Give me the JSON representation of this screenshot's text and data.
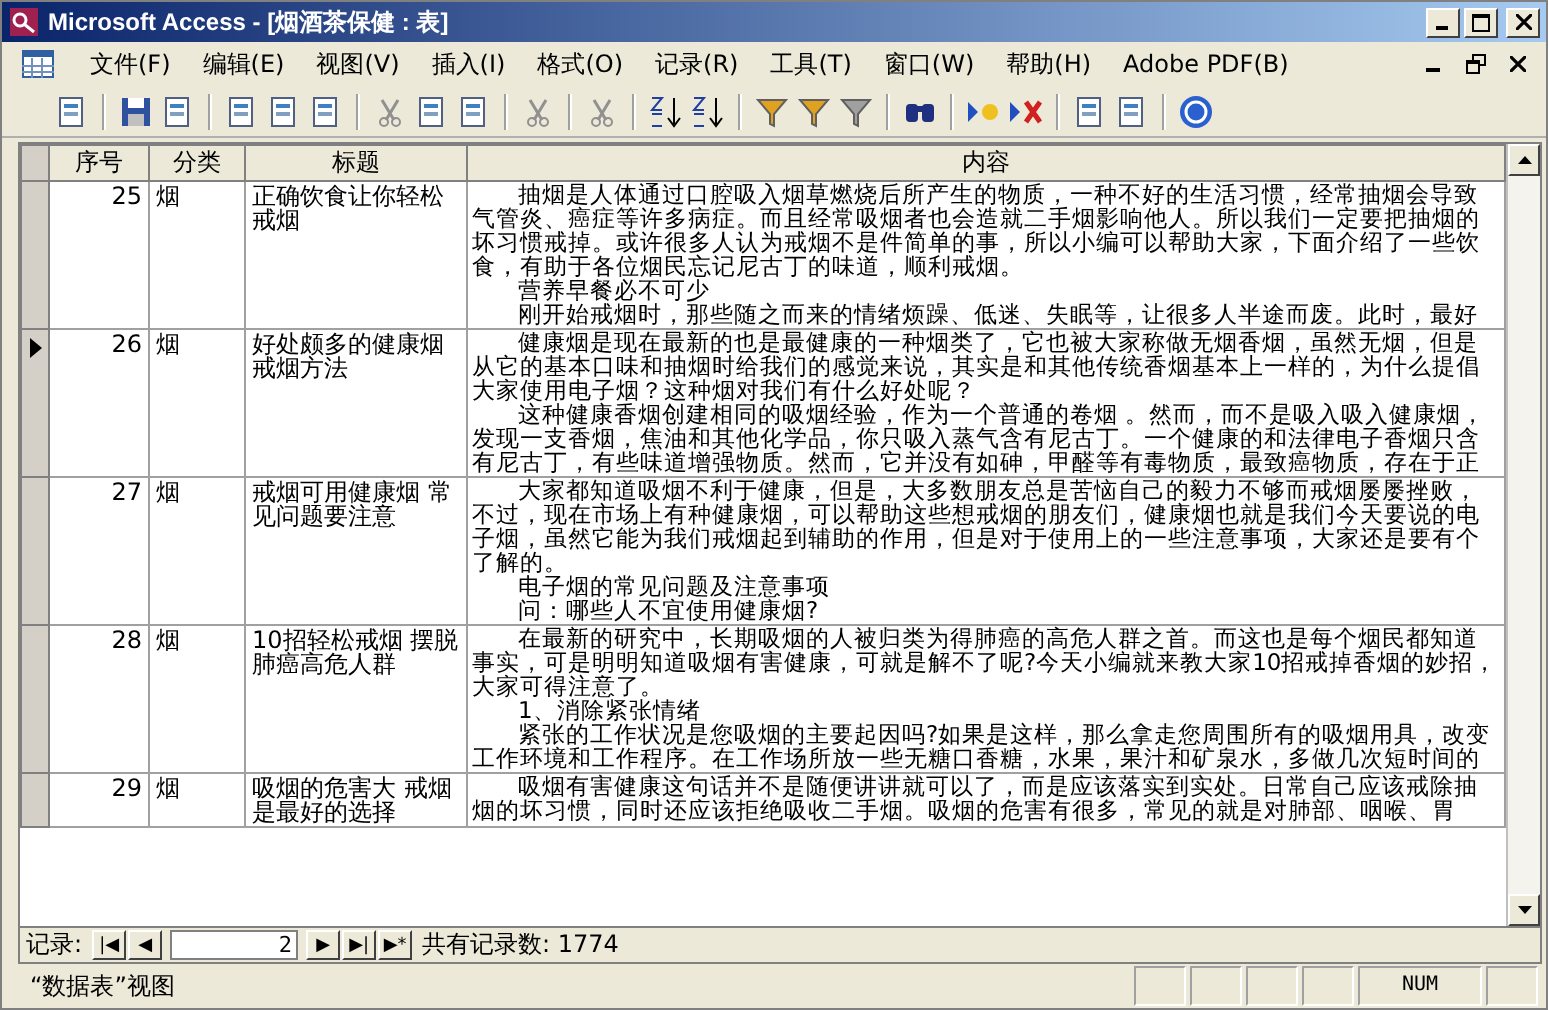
{
  "window": {
    "title": "Microsoft Access - [烟酒茶保健 : 表]"
  },
  "menu": [
    "文件(F)",
    "编辑(E)",
    "视图(V)",
    "插入(I)",
    "格式(O)",
    "记录(R)",
    "工具(T)",
    "窗口(W)",
    "帮助(H)",
    "Adobe PDF(B)"
  ],
  "table": {
    "columns": [
      "序号",
      "分类",
      "标题",
      "内容"
    ],
    "rows": [
      {
        "id": "25",
        "category": "烟",
        "title": "正确饮食让你轻松戒烟",
        "selected": false,
        "content": [
          [
            "抽烟是人体通过口腔吸入烟草燃烧后所产生的物质，一种不好的生活习惯，经常抽烟会导致",
            "气管炎、癌症等许多病症。而且经常吸烟者也会造就二手烟影响他人。所以我们一定要把抽烟的",
            "坏习惯戒掉。或许很多人认为戒烟不是件简单的事，所以小编可以帮助大家，下面介绍了一些饮",
            "食，有助于各位烟民忘记尼古丁的味道，顺利戒烟。"
          ],
          [
            "营养早餐必不可少"
          ],
          [
            "刚开始戒烟时，那些随之而来的情绪烦躁、低迷、失眠等，让很多人半途而废。此时，最好"
          ]
        ]
      },
      {
        "id": "26",
        "category": "烟",
        "title": "好处颇多的健康烟戒烟方法",
        "selected": true,
        "content": [
          [
            "健康烟是现在最新的也是最健康的一种烟类了，它也被大家称做无烟香烟，虽然无烟，但是",
            "从它的基本口味和抽烟时给我们的感觉来说，其实是和其他传统香烟基本上一样的，为什么提倡",
            "大家使用电子烟？这种烟对我们有什么好处呢？"
          ],
          [
            "这种健康香烟创建相同的吸烟经验，作为一个普通的卷烟 。然而，而不是吸入吸入健康烟，",
            "发现一支香烟，焦油和其他化学品，你只吸入蒸气含有尼古丁。一个健康的和法律电子香烟只含",
            "有尼古丁，有些味道增强物质。然而，它并没有如砷，甲醛等有毒物质，最致癌物质，存在于正"
          ]
        ]
      },
      {
        "id": "27",
        "category": "烟",
        "title": "戒烟可用健康烟 常见问题要注意",
        "selected": false,
        "content": [
          [
            "大家都知道吸烟不利于健康，但是，大多数朋友总是苦恼自己的毅力不够而戒烟屡屡挫败，",
            "不过，现在市场上有种健康烟，可以帮助这些想戒烟的朋友们，健康烟也就是我们今天要说的电",
            "子烟，虽然它能为我们戒烟起到辅助的作用，但是对于使用上的一些注意事项，大家还是要有个",
            "了解的。"
          ],
          [
            "电子烟的常见问题及注意事项"
          ],
          [
            "问：哪些人不宜使用健康烟?"
          ]
        ]
      },
      {
        "id": "28",
        "category": "烟",
        "title": "10招轻松戒烟 摆脱肺癌高危人群",
        "selected": false,
        "content": [
          [
            "在最新的研究中，长期吸烟的人被归类为得肺癌的高危人群之首。而这也是每个烟民都知道",
            "事实，可是明明知道吸烟有害健康，可就是解不了呢?今天小编就来教大家10招戒掉香烟的妙招，",
            "大家可得注意了。"
          ],
          [
            "1、消除紧张情绪"
          ],
          [
            "紧张的工作状况是您吸烟的主要起因吗?如果是这样，那么拿走您周围所有的吸烟用具，改变",
            "工作环境和工作程序。在工作场所放一些无糖口香糖，水果，果汁和矿泉水，多做几次短时间的"
          ]
        ]
      },
      {
        "id": "29",
        "category": "烟",
        "title": "吸烟的危害大 戒烟是最好的选择",
        "selected": false,
        "content": [
          [
            "吸烟有害健康这句话并不是随便讲讲就可以了，而是应该落实到实处。日常自己应该戒除抽",
            "烟的坏习惯，同时还应该拒绝吸收二手烟。吸烟的危害有很多，常见的就是对肺部、咽喉、胃"
          ]
        ]
      }
    ]
  },
  "navigator": {
    "label": "记录:",
    "buttons": [
      "|◀",
      "◀",
      "▶",
      "▶|",
      "▶*"
    ],
    "current": "2",
    "total": "共有记录数: 1774"
  },
  "status_bar": {
    "view": "“数据表”视图",
    "indicator": "NUM"
  }
}
